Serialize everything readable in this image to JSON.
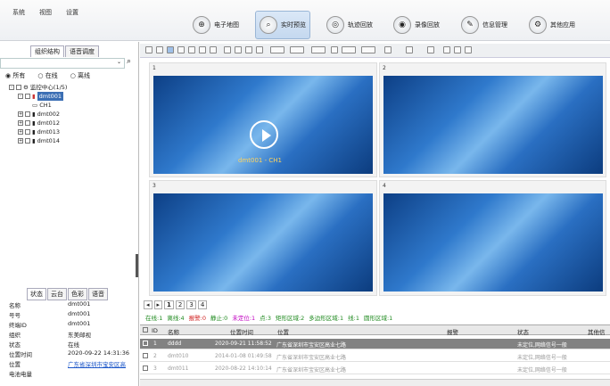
{
  "menu": [
    "系统",
    "视图",
    "设置"
  ],
  "nav": [
    {
      "label": "电子地图",
      "icon": "map-icon",
      "active": false
    },
    {
      "label": "实时预览",
      "icon": "search-icon",
      "active": true
    },
    {
      "label": "轨迹回放",
      "icon": "track-icon",
      "active": false
    },
    {
      "label": "录像回放",
      "icon": "record-icon",
      "active": false
    },
    {
      "label": "信息管理",
      "icon": "info-icon",
      "active": false
    },
    {
      "label": "其他应用",
      "icon": "gear-icon",
      "active": false
    }
  ],
  "left_tabs": [
    "组织结构",
    "语音调度"
  ],
  "radios": [
    "所有",
    "在线",
    "离线"
  ],
  "tree": {
    "root": "监控中心(1/5)",
    "items": [
      "dmt001",
      "CH1",
      "dmt002",
      "dmt012",
      "dmt013",
      "dmt014"
    ]
  },
  "bottom_tabs": [
    "状态",
    "云台",
    "色彩",
    "语音"
  ],
  "props": [
    {
      "k": "名称",
      "v": "dmt001"
    },
    {
      "k": "号号",
      "v": "dmt001"
    },
    {
      "k": "终端ID",
      "v": "dmt001"
    },
    {
      "k": "组织",
      "v": "东美邮视"
    },
    {
      "k": "状态",
      "v": "在线"
    },
    {
      "k": "位置时间",
      "v": "2020-09-22 14:31:36"
    },
    {
      "k": "位置",
      "v": "广东省深圳市宝安区高"
    },
    {
      "k": "电池电量",
      "v": ""
    }
  ],
  "video_cells": [
    "1",
    "2",
    "3",
    "4"
  ],
  "video_caption": "dmt001 - CH1",
  "pages": [
    "1",
    "2",
    "3",
    "4"
  ],
  "stats": [
    {
      "t": "在线:1",
      "c": "#1f8a1f"
    },
    {
      "t": "离线:4",
      "c": "#1f8a1f"
    },
    {
      "t": "报警:0",
      "c": "#d01f1f"
    },
    {
      "t": "静止:0",
      "c": "#1f8a1f"
    },
    {
      "t": "未定位:1",
      "c": "#c000c0"
    },
    {
      "t": "点:3",
      "c": "#1f8a1f"
    },
    {
      "t": "矩形区域:2",
      "c": "#1f8a1f"
    },
    {
      "t": "多边形区域:1",
      "c": "#1f8a1f"
    },
    {
      "t": "线:1",
      "c": "#1f8a1f"
    },
    {
      "t": "圆形区域:1",
      "c": "#1f8a1f"
    }
  ],
  "table": {
    "headers": [
      "ID",
      "名称",
      "位置时间",
      "位置",
      "报警",
      "状态",
      "其他信"
    ],
    "rows": [
      {
        "id": "1",
        "name": "dddd",
        "time": "2020-09-21 11:58:52",
        "loc": "广东省深圳市宝安区高业七路",
        "alarm": "",
        "status": "未定位,网络信号一般"
      },
      {
        "id": "2",
        "name": "dmt010",
        "time": "2014-01-08 01:49:58",
        "loc": "广东省深圳市宝安区高业七路",
        "alarm": "",
        "status": "未定位,网络信号一般"
      },
      {
        "id": "3",
        "name": "dmt011",
        "time": "2020-08-22 14:10:14",
        "loc": "广东省深圳市宝安区高业七路",
        "alarm": "",
        "status": "未定位,网络信号一般"
      }
    ]
  }
}
